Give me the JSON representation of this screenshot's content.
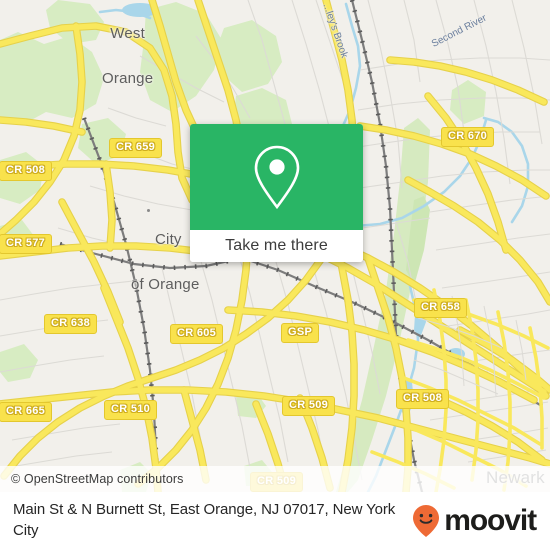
{
  "map": {
    "base_color": "#f2f0eb",
    "road_color": "#f7e04e",
    "park_color": "#d7ecc2",
    "water_color": "#a9d6ea",
    "rail_color": "#7a7a7a",
    "place_labels": [
      {
        "name": "West Orange",
        "line1": "West",
        "line2": "Orange"
      },
      {
        "name": "City of Orange",
        "line1": "City",
        "line2": "of Orange"
      },
      {
        "name": "Newark",
        "line1": "Newark",
        "line2": ""
      }
    ],
    "water_labels": [
      {
        "name": "wigwam-brook",
        "text": "...ley's Brook"
      },
      {
        "name": "second-river",
        "text": "Second River"
      }
    ],
    "shields": [
      {
        "label": "CR 659"
      },
      {
        "label": "CR 508"
      },
      {
        "label": "CR 577"
      },
      {
        "label": "CR 638"
      },
      {
        "label": "CR 665"
      },
      {
        "label": "CR 510"
      },
      {
        "label": "CR 605"
      },
      {
        "label": "GSP"
      },
      {
        "label": "CR 509"
      },
      {
        "label": "CR 509"
      },
      {
        "label": "CR 670"
      },
      {
        "label": "CR 658"
      },
      {
        "label": "CR 508"
      }
    ]
  },
  "attribution": {
    "text": "© OpenStreetMap contributors"
  },
  "popup": {
    "icon": "map-pin-icon",
    "accent_color": "#29b565",
    "button_label": "Take me there"
  },
  "bottom_bar": {
    "address": "Main St & N Burnett St, East Orange, NJ 07017, New York City",
    "brand_name": "moovit",
    "brand_icon": "moovit-pin-smiley-icon",
    "brand_color": "#ee6a35"
  }
}
